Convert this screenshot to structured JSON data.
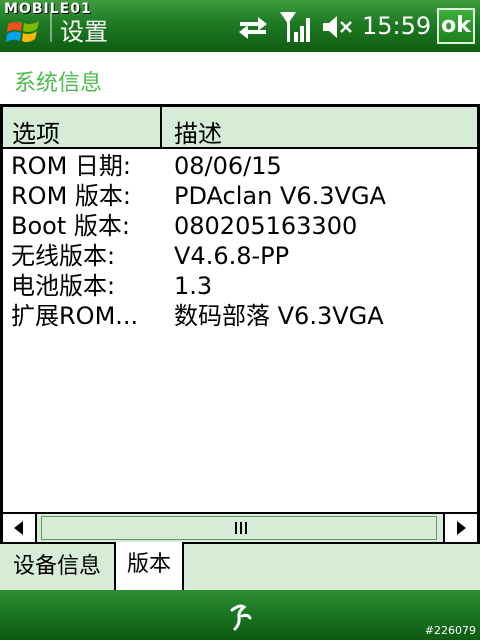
{
  "statusbar": {
    "watermark": "MOBILE01",
    "title": "设置",
    "time": "15:59",
    "ok_label": "ok"
  },
  "header": {
    "title": "系统信息"
  },
  "table": {
    "columns": [
      "选项",
      "描述"
    ],
    "rows": [
      {
        "key": "ROM 日期:",
        "value": "08/06/15"
      },
      {
        "key": "ROM 版本:",
        "value": "PDAclan V6.3VGA"
      },
      {
        "key": "Boot 版本:",
        "value": "080205163300"
      },
      {
        "key": "无线版本:",
        "value": "V4.6.8-PP"
      },
      {
        "key": "电池版本:",
        "value": "1.3"
      },
      {
        "key": "扩展ROM...",
        "value": "数码部落 V6.3VGA"
      }
    ]
  },
  "tabs": [
    {
      "label": "设备信息"
    },
    {
      "label": "版本"
    }
  ],
  "footer": {
    "image_id": "#226079"
  },
  "icons": {
    "start": "windows-flag-icon",
    "sync": "sync-arrows-icon",
    "signal": "signal-strength-icon",
    "volume": "speaker-muted-icon",
    "input": "input-panel-icon"
  },
  "colors": {
    "title_bar": "#1e7a22",
    "accent_text": "#4dbb4d",
    "header_fill": "#d6ecd6"
  }
}
